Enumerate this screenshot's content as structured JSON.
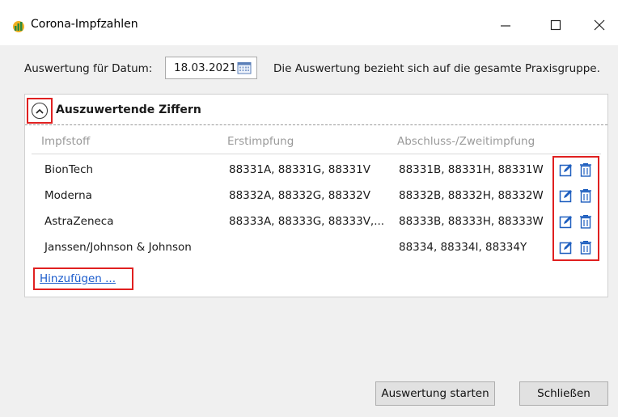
{
  "window": {
    "title": "Corona-Impfzahlen",
    "minimize_icon": "minimize-icon",
    "maximize_icon": "maximize-icon",
    "close_icon": "close-icon"
  },
  "date_row": {
    "label": "Auswertung für Datum:",
    "value": "18.03.2021",
    "info": "Die Auswertung bezieht sich auf die gesamte Praxisgruppe."
  },
  "panel": {
    "title": "Auszuwertende Ziffern",
    "columns": [
      "Impfstoff",
      "Erstimpfung",
      "Abschluss-/Zweitimpfung"
    ],
    "rows": [
      {
        "vaccine": "BionTech",
        "first": "88331A, 88331G, 88331V",
        "second": "88331B, 88331H, 88331W"
      },
      {
        "vaccine": "Moderna",
        "first": "88332A, 88332G, 88332V",
        "second": "88332B, 88332H, 88332W"
      },
      {
        "vaccine": "AstraZeneca",
        "first": "88333A, 88333G, 88333V,...",
        "second": "88333B, 88333H, 88333W"
      },
      {
        "vaccine": "Janssen/Johnson & Johnson",
        "first": "",
        "second": "88334, 88334I, 88334Y"
      }
    ],
    "add_link": "Hinzufügen ..."
  },
  "buttons": {
    "start": "Auswertung starten",
    "close": "Schließen"
  },
  "colors": {
    "highlight": "#e02020",
    "link": "#1a5bcc",
    "icon_blue": "#1f5fbf"
  }
}
